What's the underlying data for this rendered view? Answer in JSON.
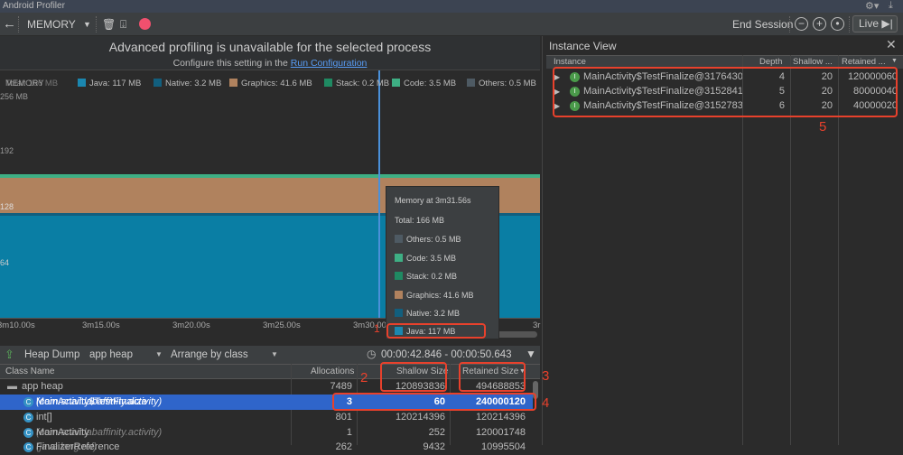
{
  "window": {
    "title": "Android Profiler"
  },
  "toolbar": {
    "profiler": "MEMORY",
    "end_session": "End Session",
    "live": "Live"
  },
  "banner": {
    "title": "Advanced profiling is unavailable for the selected process",
    "subtitle": "Configure this setting in the",
    "link": "Run Configuration"
  },
  "legend": {
    "label": "MEMORY",
    "total": "Total: 166 MB",
    "items": [
      {
        "label": "Java: 117 MB",
        "color": "#1b87b0"
      },
      {
        "label": "Native: 3.2 MB",
        "color": "#125f7e"
      },
      {
        "label": "Graphics: 41.6 MB",
        "color": "#b0825e"
      },
      {
        "label": "Stack: 0.2 MB",
        "color": "#1f8a62"
      },
      {
        "label": "Code: 3.5 MB",
        "color": "#3eaf84"
      },
      {
        "label": "Others: 0.5 MB",
        "color": "#4e5a63"
      }
    ]
  },
  "chart_data": {
    "type": "area",
    "yticks": [
      "256 MB",
      "192",
      "128",
      "64"
    ],
    "xticks": [
      "3m10.00s",
      "3m15.00s",
      "3m20.00s",
      "3m25.00s",
      "3m30.00s",
      "3r"
    ]
  },
  "tooltip": {
    "title": "Memory at 3m31.56s",
    "total": "Total: 166 MB",
    "items": [
      {
        "label": "Others: 0.5 MB",
        "color": "#4e5a63"
      },
      {
        "label": "Code: 3.5 MB",
        "color": "#3eaf84"
      },
      {
        "label": "Stack: 0.2 MB",
        "color": "#1f8a62"
      },
      {
        "label": "Graphics: 41.6 MB",
        "color": "#b0825e"
      },
      {
        "label": "Native: 3.2 MB",
        "color": "#125f7e"
      },
      {
        "label": "Java: 117 MB",
        "color": "#1b87b0"
      }
    ]
  },
  "heap": {
    "heap_dump": "Heap Dump",
    "heap": "app heap",
    "arrange": "Arrange by class",
    "range": "00:00:42.846 - 00:00:50.643",
    "columns": [
      "Class Name",
      "Allocations",
      "Shallow Size",
      "Retained Size"
    ],
    "rows": [
      {
        "name": "app heap",
        "pkg": "",
        "alloc": "7489",
        "shallow": "120893836",
        "retained": "494688853"
      },
      {
        "name": "MainActivity$TestFinalize",
        "pkg": "(com.snail.labaffinity.activity)",
        "alloc": "3",
        "shallow": "60",
        "retained": "240000120"
      },
      {
        "name": "int[]",
        "pkg": "",
        "alloc": "801",
        "shallow": "120214396",
        "retained": "120214396"
      },
      {
        "name": "MainActivity",
        "pkg": "(com.snail.labaffinity.activity)",
        "alloc": "1",
        "shallow": "252",
        "retained": "120001748"
      },
      {
        "name": "FinalizerReference",
        "pkg": "(java.lang.ref)",
        "alloc": "262",
        "shallow": "9432",
        "retained": "10995504"
      }
    ]
  },
  "instance_view": {
    "title": "Instance View",
    "columns": [
      "Instance",
      "Depth",
      "Shallow ...",
      "Retained ..."
    ],
    "rows": [
      {
        "name": "MainActivity$TestFinalize@3176430",
        "depth": "4",
        "shallow": "20",
        "retained": "120000060"
      },
      {
        "name": "MainActivity$TestFinalize@3152841",
        "depth": "5",
        "shallow": "20",
        "retained": "80000040"
      },
      {
        "name": "MainActivity$TestFinalize@3152783",
        "depth": "6",
        "shallow": "20",
        "retained": "40000020"
      }
    ]
  },
  "annotations": [
    "1",
    "2",
    "3",
    "4",
    "5"
  ]
}
